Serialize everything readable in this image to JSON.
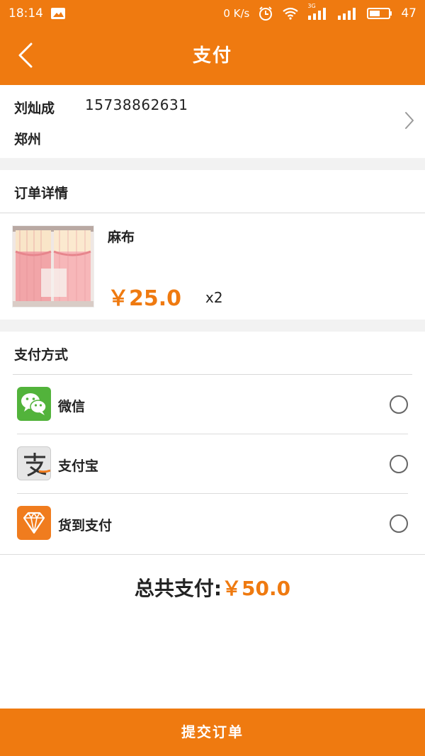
{
  "status_bar": {
    "time": "18:14",
    "network_speed": "0 K/s",
    "network_type": "3G",
    "battery": "47",
    "icons": [
      "image-notification-icon",
      "alarm-icon",
      "wifi-icon",
      "signal-3g-icon",
      "signal-icon",
      "battery-icon"
    ]
  },
  "header": {
    "title": "支付",
    "back_icon": "chevron-left-icon"
  },
  "address": {
    "name": "刘灿成",
    "phone": "15738862631",
    "city": "郑州",
    "chevron_icon": "chevron-right-icon"
  },
  "order": {
    "section_title": "订单详情",
    "items": [
      {
        "name": "麻布",
        "price": "￥25.0",
        "quantity": "x2",
        "thumbnail": "pink-curtain-image"
      }
    ]
  },
  "payment": {
    "section_title": "支付方式",
    "methods": [
      {
        "label": "微信",
        "icon": "wechat-icon",
        "color": "#52b33b",
        "selected": false
      },
      {
        "label": "支付宝",
        "icon": "alipay-icon",
        "color": "#e6e6e6",
        "selected": false
      },
      {
        "label": "货到支付",
        "icon": "diamond-icon",
        "color": "#f07c1e",
        "selected": false
      }
    ]
  },
  "total": {
    "label": "总共支付:",
    "value": "￥50.0"
  },
  "submit": {
    "label": "提交订单"
  },
  "colors": {
    "accent": "#ef7a10",
    "background": "#f2f2f2"
  }
}
